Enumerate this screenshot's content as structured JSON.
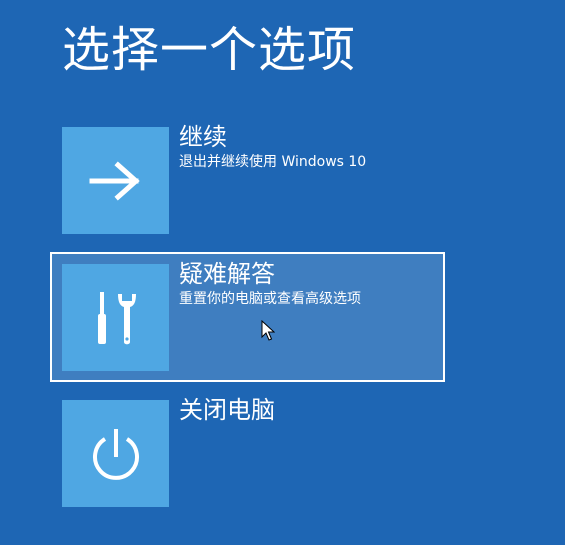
{
  "page": {
    "title": "选择一个选项"
  },
  "options": [
    {
      "title": "继续",
      "description": "退出并继续使用 Windows 10",
      "icon": "arrow-right-icon"
    },
    {
      "title": "疑难解答",
      "description": "重置你的电脑或查看高级选项",
      "icon": "tools-icon"
    },
    {
      "title": "关闭电脑",
      "icon": "power-icon"
    }
  ],
  "colors": {
    "background": "#1e66b4",
    "tile": "#4fa7e3",
    "selected_background": "#3f7ec0",
    "text": "#ffffff"
  }
}
